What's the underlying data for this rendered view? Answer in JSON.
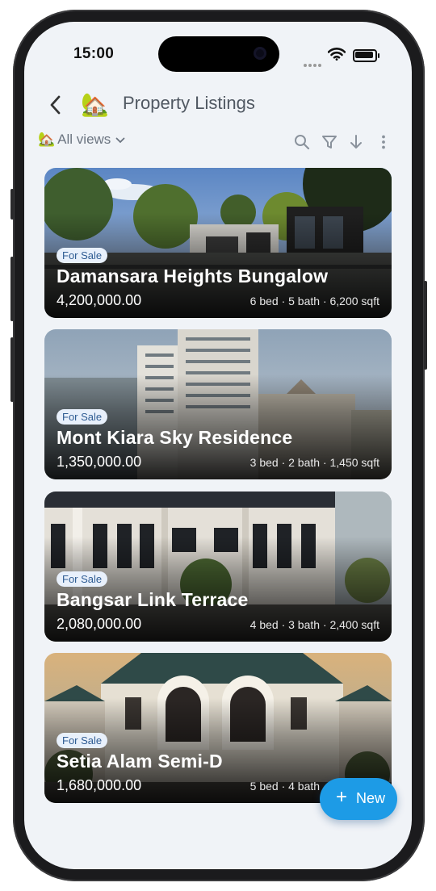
{
  "status": {
    "time": "15:00"
  },
  "header": {
    "back_icon": "chevron-left-icon",
    "emoji": "🏡",
    "title": "Property Listings"
  },
  "toolbar": {
    "view_emoji": "🏡",
    "view_label": "All views",
    "icons": [
      "search-icon",
      "filter-icon",
      "sort-down-icon",
      "more-vertical-icon"
    ]
  },
  "listings": [
    {
      "badge": "For Sale",
      "title": "Damansara Heights Bungalow",
      "price": "4,200,000.00",
      "specs": "6 bed · 5 bath · 6,200 sqft",
      "theme": "bungalow"
    },
    {
      "badge": "For Sale",
      "title": "Mont Kiara Sky Residence",
      "price": "1,350,000.00",
      "specs": "3 bed · 2 bath · 1,450 sqft",
      "theme": "tower"
    },
    {
      "badge": "For Sale",
      "title": "Bangsar Link Terrace",
      "price": "2,080,000.00",
      "specs": "4 bed · 3 bath · 2,400 sqft",
      "theme": "terrace"
    },
    {
      "badge": "For Sale",
      "title": "Setia Alam Semi-D",
      "price": "1,680,000.00",
      "specs": "5 bed · 4 bath · 3,800 sqft",
      "theme": "semid"
    }
  ],
  "fab": {
    "label": "New"
  },
  "colors": {
    "accent": "#1d9be6",
    "badge_bg": "#e8f0fb",
    "badge_text": "#2f5c93",
    "screen_bg": "#f0f3f7"
  }
}
